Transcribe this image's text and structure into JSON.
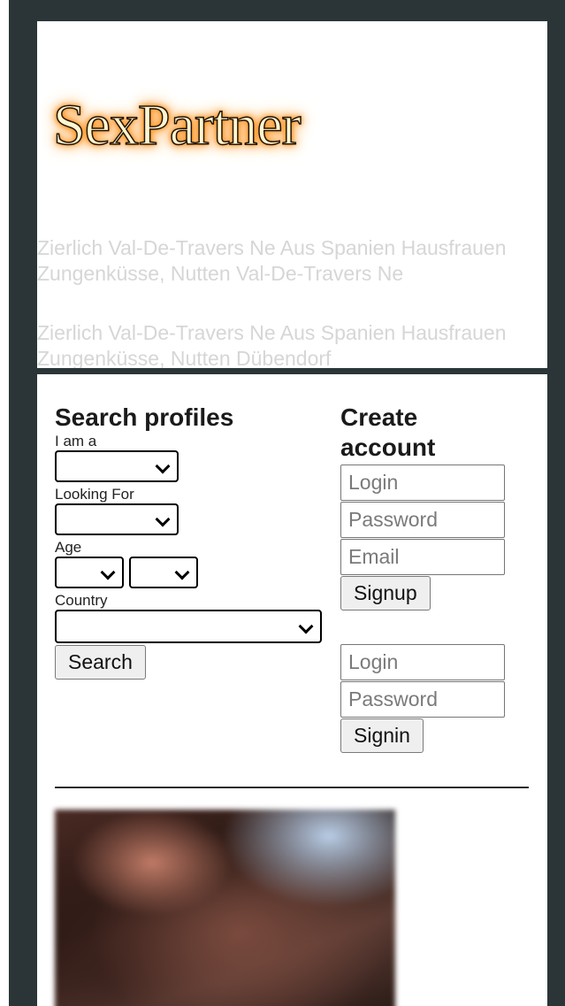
{
  "header": {
    "logo_text": "SexPartner",
    "tagline_1": "Zierlich Val-De-Travers Ne Aus Spanien Hausfrauen Zungenküsse, Nutten Val-De-Travers Ne",
    "tagline_2": "Zierlich Val-De-Travers Ne Aus Spanien Hausfrauen Zungenküsse, Nutten Dübendorf"
  },
  "search": {
    "title": "Search profiles",
    "i_am_label": "I am a",
    "looking_for_label": "Looking For",
    "age_label": "Age",
    "country_label": "Country",
    "search_button": "Search"
  },
  "create_account": {
    "title": "Create account",
    "login_placeholder": "Login",
    "password_placeholder": "Password",
    "email_placeholder": "Email",
    "signup_button": "Signup"
  },
  "signin": {
    "login_placeholder": "Login",
    "password_placeholder": "Password",
    "signin_button": "Signin"
  },
  "colors": {
    "page_background": "#2b3537",
    "panel_background": "#ffffff",
    "tagline_text": "#d6d6d6",
    "logo_glow": "#ff8c1a"
  },
  "icons": {
    "select_arrow": "chevron-down-icon"
  }
}
